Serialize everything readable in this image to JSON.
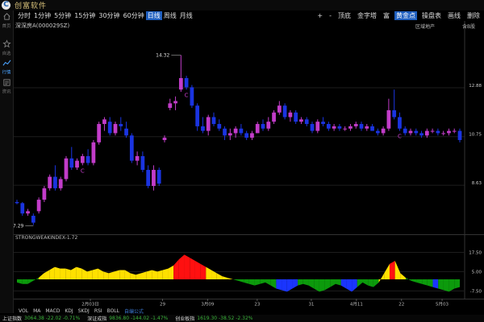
{
  "app": {
    "title": "创富软件",
    "logo_letter": "C"
  },
  "sidebar": {
    "items": [
      {
        "label": "首页",
        "icon": "home-icon",
        "active": false
      },
      {
        "label": "自选",
        "icon": "star-icon",
        "active": false
      },
      {
        "label": "行情",
        "icon": "chart-icon",
        "active": true
      },
      {
        "label": "资讯",
        "icon": "news-icon",
        "active": false
      }
    ]
  },
  "toolbar": {
    "periods": [
      "分时",
      "1分钟",
      "5分钟",
      "15分钟",
      "30分钟",
      "60分钟",
      "日线",
      "周线",
      "月线"
    ],
    "active_period": 6,
    "right_items": [
      "+",
      "-",
      "顶底",
      "金字塔",
      "富",
      "黄金点",
      "操盘表",
      "画线",
      "删除"
    ],
    "right_active": 5
  },
  "stock": {
    "name_code": "深深房A(000029SZ)",
    "sector": "区域地产",
    "fq": "含B股"
  },
  "chart_data": {
    "type": "candlestick",
    "price_axis": {
      "ylim": [
        6.6,
        15.3
      ],
      "ticks": [
        "12.88",
        "10.75",
        "8.63"
      ]
    },
    "candles": [
      [
        7.9,
        8.0,
        7.8,
        7.85
      ],
      [
        7.85,
        7.9,
        7.3,
        7.4
      ],
      [
        7.4,
        7.6,
        7.3,
        7.5
      ],
      [
        7.3,
        7.4,
        6.9,
        7.0
      ],
      [
        7.5,
        8.1,
        7.4,
        8.0
      ],
      [
        8.0,
        8.6,
        7.9,
        8.5
      ],
      [
        8.5,
        9.1,
        8.4,
        9.0
      ],
      [
        9.0,
        9.5,
        8.4,
        8.5
      ],
      [
        8.5,
        9.0,
        8.4,
        8.9
      ],
      [
        8.9,
        9.9,
        8.8,
        9.8
      ],
      [
        9.8,
        10.3,
        9.3,
        9.4
      ],
      [
        9.4,
        9.8,
        9.3,
        9.7
      ],
      [
        9.6,
        10.0,
        9.5,
        9.9
      ],
      [
        9.9,
        10.2,
        9.5,
        9.6
      ],
      [
        9.6,
        10.6,
        9.5,
        10.5
      ],
      [
        10.5,
        11.4,
        10.4,
        11.3
      ],
      [
        11.3,
        11.6,
        11.0,
        11.5
      ],
      [
        11.4,
        11.6,
        10.8,
        10.9
      ],
      [
        10.9,
        11.4,
        10.8,
        11.3
      ],
      [
        11.3,
        11.6,
        11.0,
        11.2
      ],
      [
        11.1,
        11.4,
        10.7,
        10.8
      ],
      [
        10.8,
        10.9,
        9.6,
        9.7
      ],
      [
        9.7,
        10.1,
        9.5,
        9.9
      ],
      [
        9.9,
        10.1,
        9.2,
        9.3
      ],
      [
        9.3,
        9.5,
        8.5,
        8.6
      ],
      [
        8.6,
        9.5,
        8.4,
        9.3
      ],
      [
        9.3,
        9.4,
        8.6,
        8.7
      ],
      [
        10.6,
        10.8,
        10.5,
        10.7
      ],
      [
        12.0,
        12.4,
        11.9,
        12.2
      ],
      [
        12.2,
        12.5,
        11.9,
        12.3
      ],
      [
        12.8,
        14.3,
        12.7,
        13.3
      ],
      [
        13.3,
        13.4,
        12.8,
        12.9
      ],
      [
        12.9,
        13.0,
        12.0,
        12.1
      ],
      [
        12.1,
        12.2,
        11.0,
        11.2
      ],
      [
        11.2,
        11.6,
        10.9,
        11.0
      ],
      [
        11.0,
        11.7,
        10.8,
        11.6
      ],
      [
        11.6,
        11.8,
        11.2,
        11.3
      ],
      [
        11.3,
        11.5,
        11.0,
        11.1
      ],
      [
        11.1,
        11.2,
        10.6,
        10.8
      ],
      [
        10.8,
        11.1,
        10.6,
        10.9
      ],
      [
        10.9,
        11.2,
        10.7,
        11.1
      ],
      [
        11.1,
        11.3,
        10.8,
        10.9
      ],
      [
        10.9,
        11.0,
        10.6,
        10.7
      ],
      [
        10.7,
        11.0,
        10.6,
        10.9
      ],
      [
        10.9,
        11.4,
        10.9,
        11.3
      ],
      [
        11.3,
        11.5,
        11.0,
        11.1
      ],
      [
        11.1,
        11.6,
        11.0,
        11.4
      ],
      [
        11.4,
        11.9,
        11.3,
        11.8
      ],
      [
        11.8,
        12.3,
        11.7,
        12.1
      ],
      [
        12.1,
        12.2,
        11.5,
        11.6
      ],
      [
        11.6,
        11.9,
        11.4,
        11.8
      ],
      [
        11.8,
        11.9,
        11.3,
        11.4
      ],
      [
        11.4,
        11.6,
        11.3,
        11.5
      ],
      [
        11.5,
        11.6,
        11.2,
        11.3
      ],
      [
        11.3,
        11.4,
        10.9,
        11.0
      ],
      [
        11.0,
        11.5,
        10.9,
        11.4
      ],
      [
        11.4,
        11.6,
        11.2,
        11.3
      ],
      [
        11.3,
        11.4,
        11.0,
        11.1
      ],
      [
        11.1,
        11.3,
        11.0,
        11.2
      ],
      [
        11.2,
        11.3,
        11.0,
        11.1
      ],
      [
        11.1,
        11.2,
        11.0,
        11.1
      ],
      [
        11.1,
        11.3,
        11.0,
        11.2
      ],
      [
        11.2,
        11.4,
        11.1,
        11.3
      ],
      [
        11.3,
        11.4,
        11.0,
        11.1
      ],
      [
        11.1,
        11.3,
        11.0,
        11.2
      ],
      [
        11.2,
        11.3,
        11.0,
        11.0
      ],
      [
        11.0,
        11.1,
        10.8,
        10.9
      ],
      [
        10.9,
        11.2,
        10.8,
        11.1
      ],
      [
        11.1,
        12.4,
        11.0,
        11.9
      ],
      [
        11.9,
        12.8,
        11.5,
        11.6
      ],
      [
        11.6,
        11.8,
        11.0,
        11.1
      ],
      [
        11.1,
        11.2,
        10.8,
        10.9
      ],
      [
        10.9,
        11.1,
        10.8,
        11.0
      ],
      [
        11.0,
        11.1,
        10.8,
        10.9
      ],
      [
        10.9,
        11.0,
        10.7,
        10.8
      ],
      [
        10.8,
        11.1,
        10.7,
        11.0
      ],
      [
        11.0,
        11.1,
        10.9,
        11.0
      ],
      [
        11.0,
        11.1,
        10.8,
        10.9
      ],
      [
        10.9,
        11.0,
        10.8,
        10.9
      ],
      [
        10.9,
        11.1,
        10.8,
        11.0
      ],
      [
        11.0,
        11.1,
        10.9,
        11.0
      ],
      [
        11.0,
        11.1,
        10.5,
        10.6
      ]
    ],
    "high_label": "14.32",
    "low_label": "7.29",
    "markers": [
      {
        "i": 12,
        "label": "C"
      },
      {
        "i": 31,
        "label": "C"
      },
      {
        "i": 70,
        "label": "C"
      }
    ],
    "indicator": {
      "name": "STRONGWEAKINDEX-1.72",
      "ticks": [
        "17.50",
        "5.00",
        "-7.50"
      ],
      "ylim": [
        -12,
        24
      ],
      "values": [
        -2,
        -3,
        -3,
        -1,
        1,
        4,
        6,
        8,
        7,
        7,
        6,
        8,
        7,
        5,
        6,
        7,
        5,
        4,
        5,
        6,
        6,
        4,
        3,
        4,
        5,
        6,
        5,
        6,
        7,
        9,
        13,
        16,
        14,
        12,
        10,
        8,
        6,
        4,
        2,
        1,
        0,
        -1,
        -2,
        -3,
        -4,
        -3,
        -2,
        -4,
        -6,
        -7,
        -8,
        -6,
        -4,
        -3,
        -4,
        -6,
        -8,
        -7,
        -5,
        -3,
        -4,
        -6,
        -8,
        -5,
        -2,
        -4,
        -5,
        -2,
        4,
        10,
        12,
        4,
        1,
        -1,
        -2,
        -3,
        -4,
        -5,
        -6,
        -7,
        -8,
        -6,
        -5
      ],
      "colors": [
        "#0c9a0c",
        "#ffe000",
        "#ff1010",
        "#1a35ff"
      ]
    },
    "dates": [
      "2月03日",
      "29",
      "3月09",
      "23",
      "31",
      "4月11",
      "22",
      "5月03"
    ]
  },
  "indicator_tabs": [
    "VOL",
    "MA",
    "MACD",
    "KDJ",
    "SKDJ",
    "RSI",
    "BOLL",
    "自编公式"
  ],
  "statusbar": [
    {
      "name": "上证指数",
      "values": "3064.38 -22.02 -0.71%",
      "dir": "dn"
    },
    {
      "name": "深证成指",
      "values": "9836.80 -144.02 -1.47%",
      "dir": "dn"
    },
    {
      "name": "创业板指",
      "values": "1619.30 -38.52 -2.32%",
      "dir": "dn"
    }
  ]
}
